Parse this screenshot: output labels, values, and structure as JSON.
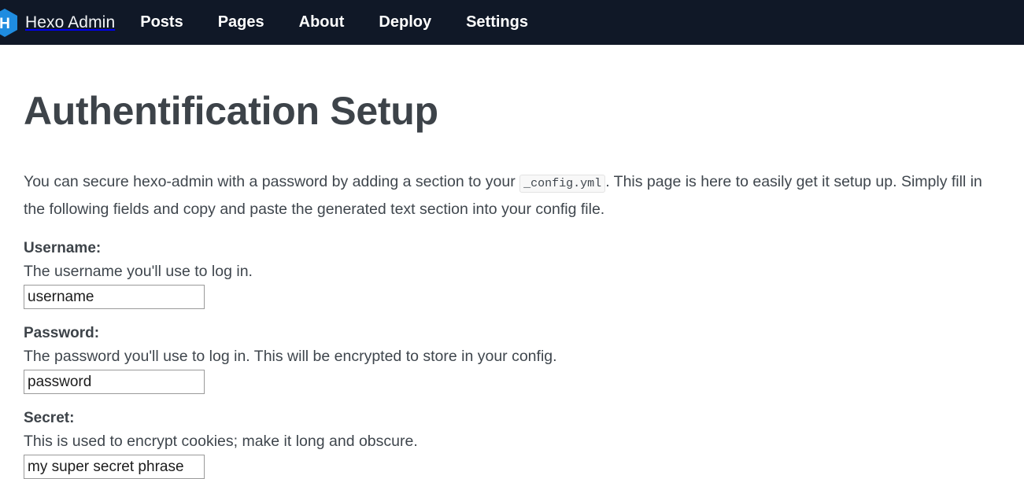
{
  "navbar": {
    "logo_icon": "hexo-hexagon-logo-icon",
    "logo_letter": "H",
    "logo_color": "#1f8ce0",
    "brand": "Hexo Admin",
    "background": "#101827",
    "links": [
      {
        "label": "Posts"
      },
      {
        "label": "Pages"
      },
      {
        "label": "About"
      },
      {
        "label": "Deploy"
      },
      {
        "label": "Settings"
      }
    ]
  },
  "main": {
    "title": "Authentification Setup",
    "intro": {
      "part1": "You can secure hexo-admin with a password by adding a section to your ",
      "code": "_config.yml",
      "part2": ". This page is here to easily get it setup up. Simply fill in the following fields and copy and paste the generated text section into your config file."
    },
    "fields": [
      {
        "label": "Username:",
        "help": "The username you'll use to log in.",
        "value": "username",
        "placeholder": "username"
      },
      {
        "label": "Password:",
        "help": "The password you'll use to log in. This will be encrypted to store in your config.",
        "value": "password",
        "placeholder": "password"
      },
      {
        "label": "Secret:",
        "help": "This is used to encrypt cookies; make it long and obscure.",
        "value": "my super secret phrase",
        "placeholder": "my super secret phrase"
      }
    ]
  }
}
